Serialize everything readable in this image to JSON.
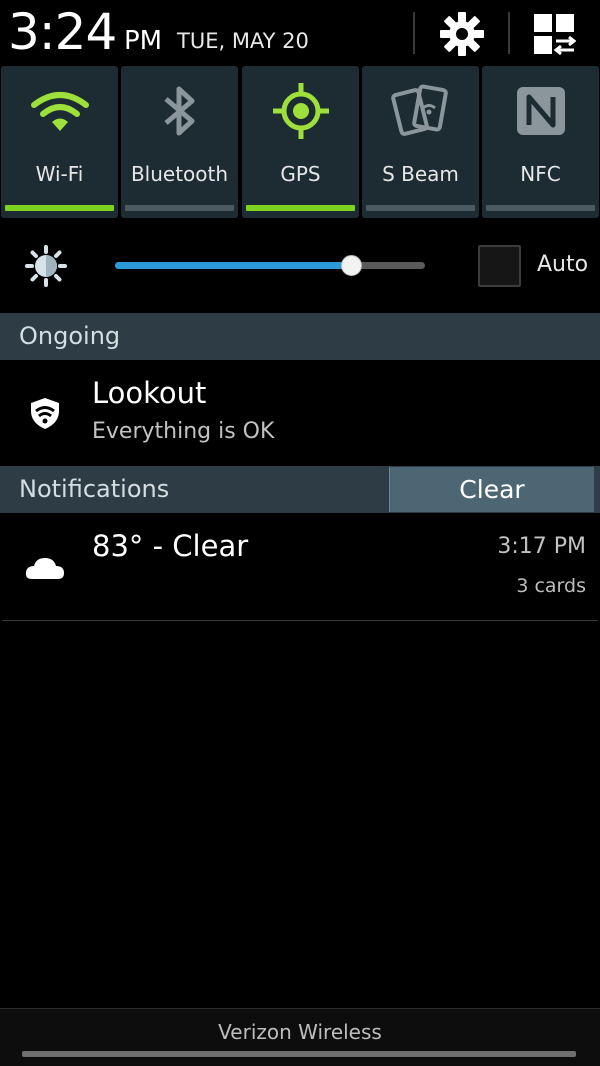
{
  "header": {
    "time": "3:24",
    "ampm": "PM",
    "date": "TUE, MAY 20",
    "settings_icon": "gear-icon",
    "grid_icon": "quick-settings-grid-icon"
  },
  "toggles": [
    {
      "label": "Wi-Fi",
      "icon": "wifi-icon",
      "on": true
    },
    {
      "label": "Bluetooth",
      "icon": "bluetooth-icon",
      "on": false
    },
    {
      "label": "GPS",
      "icon": "gps-icon",
      "on": true
    },
    {
      "label": "S Beam",
      "icon": "s-beam-icon",
      "on": false
    },
    {
      "label": "NFC",
      "icon": "nfc-icon",
      "on": false
    }
  ],
  "brightness": {
    "icon": "brightness-icon",
    "level": 0.76,
    "auto_label": "Auto",
    "auto_checked": false
  },
  "ongoing": {
    "header": "Ongoing",
    "items": [
      {
        "title": "Lookout",
        "subtitle": "Everything is OK",
        "icon": "lookout-shield-icon"
      }
    ]
  },
  "notifications": {
    "header": "Notifications",
    "clear_label": "Clear",
    "items": [
      {
        "title": "83° - Clear",
        "time": "3:17 PM",
        "extra": "3 cards",
        "icon": "cloud-icon"
      }
    ]
  },
  "footer": {
    "carrier": "Verizon Wireless"
  },
  "colors": {
    "accent_on": "#7ed321",
    "slider": "#2b9ad6",
    "toggle_bg": "#1d2b33",
    "section_bg": "#2e3d45"
  }
}
